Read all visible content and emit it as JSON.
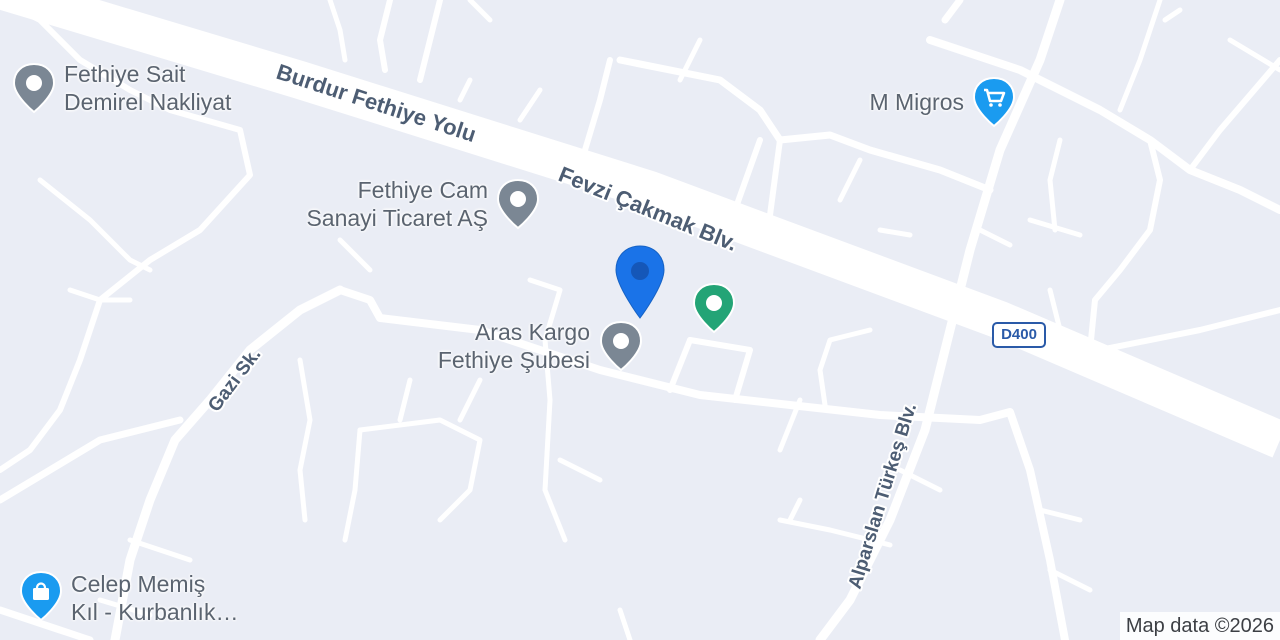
{
  "map": {
    "roads": {
      "burdur_fethiye_yolu": "Burdur Fethiye Yolu",
      "fevzi_cakmak": "Fevzi Çakmak Blv.",
      "alparslan_turkes": "Alparslan Türkeş Blv.",
      "gazi": "Gazi Sk.",
      "highway_shield": "D400"
    },
    "pois": [
      {
        "id": "fethiye-sait",
        "lines": [
          "Fethiye Sait",
          "Demirel Nakliyat"
        ],
        "icon": "pin-icon",
        "color": "#7b8794"
      },
      {
        "id": "fethiye-cam",
        "lines": [
          "Fethiye Cam",
          "Sanayi Ticaret AŞ"
        ],
        "icon": "pin-icon",
        "color": "#7b8794"
      },
      {
        "id": "aras-kargo",
        "lines": [
          "Aras Kargo",
          "Fethiye Şubesi"
        ],
        "icon": "pin-icon",
        "color": "#7b8794"
      },
      {
        "id": "m-migros",
        "lines": [
          "M Migros"
        ],
        "icon": "shopping-cart-icon",
        "color": "#1a9bf0"
      },
      {
        "id": "celep-memis",
        "lines": [
          "Celep Memiş",
          "Kıl - Kurbanlık…"
        ],
        "icon": "shopping-bag-icon",
        "color": "#1a9bf0"
      },
      {
        "id": "green-poi",
        "lines": [],
        "icon": "pin-icon",
        "color": "#23a476"
      }
    ],
    "selected_marker": {
      "icon": "location-marker-icon",
      "color": "#1a73e8"
    },
    "attribution": "Map data ©2026"
  },
  "colors": {
    "background": "#eaedf5",
    "road": "#ffffff",
    "label": "#4d5d73",
    "poi_gray": "#7b8794",
    "poi_blue": "#1a9bf0",
    "poi_green": "#23a476",
    "marker": "#1a73e8"
  }
}
